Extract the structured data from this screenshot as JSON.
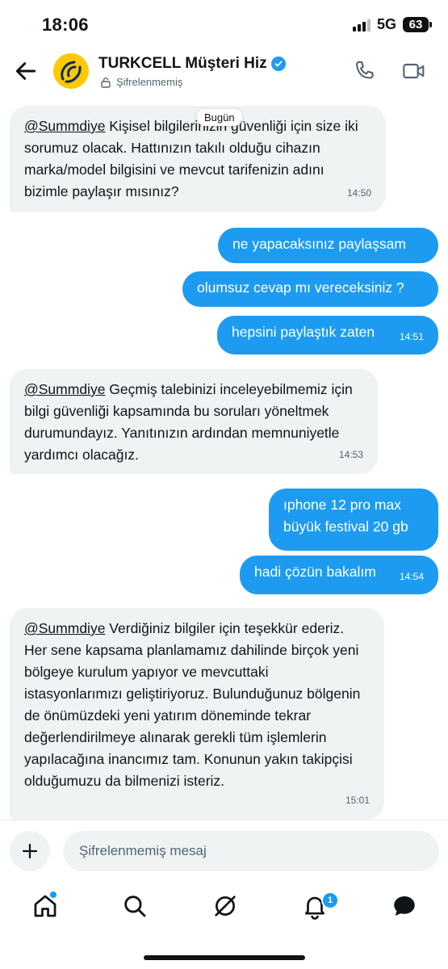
{
  "status_bar": {
    "time": "18:06",
    "network": "5G",
    "battery": "63"
  },
  "header": {
    "name": "TURKCELL Müşteri Hiz",
    "encryption": "Şifrelenmemiş"
  },
  "date_divider": "Bugün",
  "messages": [
    {
      "from": "them",
      "mention": "@Summdiye",
      "text": " Kişisel bilgilerinizin güvenliği için size iki sorumuz olacak. Hattınızın takılı olduğu cihazın marka/model bilgisini ve mevcut tarifenizin adını bizimle paylaşır mısınız?",
      "time": "14:50"
    },
    {
      "from": "me",
      "text": "ne yapacaksınız paylaşsam",
      "time": ""
    },
    {
      "from": "me",
      "text": "olumsuz cevap mı vereceksiniz ?",
      "time": ""
    },
    {
      "from": "me",
      "text": "hepsini paylaştık zaten",
      "time": "14:51"
    },
    {
      "from": "them",
      "mention": "@Summdiye",
      "text": " Geçmiş talebinizi inceleyebilmemiz için bilgi güvenliği kapsamında bu soruları yöneltmek durumundayız. Yanıtınızın ardından memnuniyetle yardımcı olacağız.",
      "time": "14:53"
    },
    {
      "from": "me",
      "text": "ıphone 12 pro max büyük festival 20 gb",
      "time": ""
    },
    {
      "from": "me",
      "text": "hadi çözün bakalım",
      "time": "14:54"
    },
    {
      "from": "them",
      "mention": "@Summdiye",
      "text": "  Verdiğiniz bilgiler için teşekkür ederiz. Her sene kapsama planlamamız dahilinde birçok yeni bölgeye kurulum yapıyor ve mevcuttaki istasyonlarımızı geliştiriyoruz. Bulunduğunuz bölgenin de önümüzdeki yeni yatırım döneminde tekrar değerlendirilmeye alınarak gerekli tüm işlemlerin yapılacağına inancımız tam. Konunun yakın takipçisi olduğumuzu da bilmenizi isteriz.",
      "time": "15:01"
    }
  ],
  "composer": {
    "placeholder": "Şifrelenmemiş mesaj"
  },
  "nav": {
    "items": [
      "home-icon",
      "search-icon",
      "grok-icon",
      "notifications-icon",
      "messages-icon"
    ],
    "notification_count": "1"
  },
  "colors": {
    "accent": "#1d9bf0",
    "incoming_bubble": "#eff3f4",
    "brand": "#ffc900"
  }
}
